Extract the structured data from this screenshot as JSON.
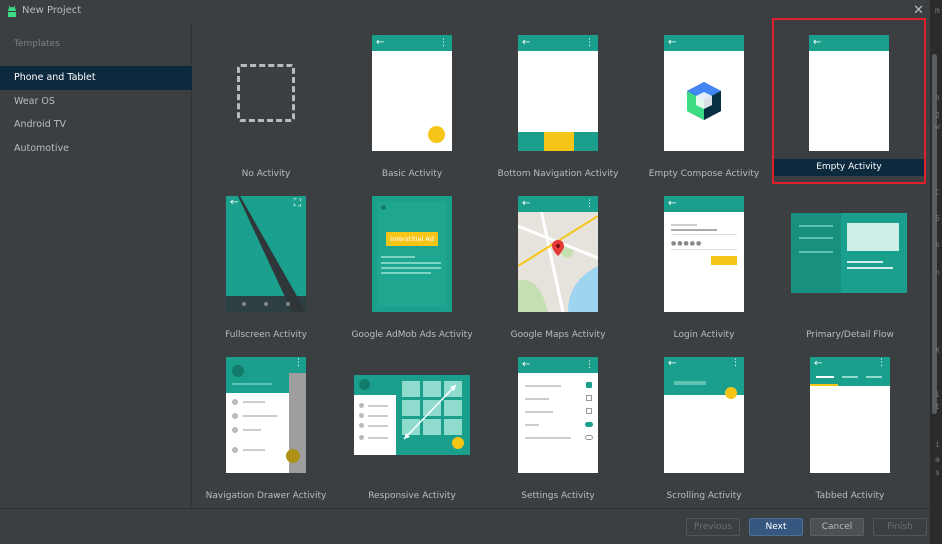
{
  "window": {
    "title": "New Project"
  },
  "sidebar": {
    "header": "Templates",
    "items": [
      {
        "label": "Phone and Tablet",
        "selected": true
      },
      {
        "label": "Wear OS",
        "selected": false
      },
      {
        "label": "Android TV",
        "selected": false
      },
      {
        "label": "Automotive",
        "selected": false
      }
    ]
  },
  "templates": [
    {
      "label": "No Activity"
    },
    {
      "label": "Basic Activity"
    },
    {
      "label": "Bottom Navigation Activity"
    },
    {
      "label": "Empty Compose Activity"
    },
    {
      "label": "Empty Activity",
      "selected": true
    },
    {
      "label": "Fullscreen Activity"
    },
    {
      "label": "Google AdMob Ads Activity",
      "ad_text": "Interstitial Ad"
    },
    {
      "label": "Google Maps Activity"
    },
    {
      "label": "Login Activity"
    },
    {
      "label": "Primary/Detail Flow"
    },
    {
      "label": "Navigation Drawer Activity"
    },
    {
      "label": "Responsive Activity"
    },
    {
      "label": "Settings Activity"
    },
    {
      "label": "Scrolling Activity"
    },
    {
      "label": "Tabbed Activity"
    }
  ],
  "footer": {
    "previous": "Previous",
    "next": "Next",
    "cancel": "Cancel",
    "finish": "Finish"
  },
  "colors": {
    "accent_teal": "#199f8c",
    "fab_yellow": "#f5c518",
    "selection_red": "#e0202a",
    "selection_bg": "#0d293e",
    "primary_button": "#365880"
  },
  "edge_glyphs": [
    "m",
    "n",
    "2",
    "w",
    "C",
    "6",
    "s",
    "n",
    "X",
    "i",
    "t",
    "i",
    "a",
    "s"
  ]
}
